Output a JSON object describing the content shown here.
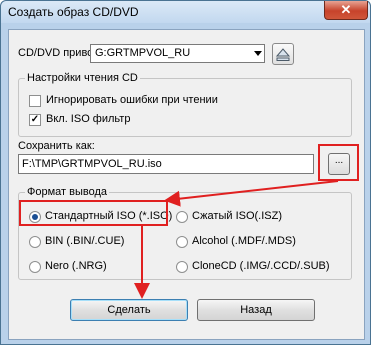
{
  "window": {
    "title": "Создать образ CD/DVD",
    "close_label": "✕"
  },
  "drive": {
    "label": "CD/DVD привод:",
    "selected": "G:GRTMPVOL_RU"
  },
  "read_settings": {
    "title": "Настройки чтения CD",
    "ignore_errors_label": "Игнорировать ошибки при чтении",
    "ignore_errors_checked": false,
    "iso_filter_label": "Вкл. ISO фильтр",
    "iso_filter_checked": true
  },
  "save_as": {
    "label": "Сохранить как:",
    "path": "F:\\TMP\\GRTMPVOL_RU.iso",
    "browse_label": "..."
  },
  "output_format": {
    "title": "Формат вывода",
    "selected": "Стандартный ISO (*.ISO)",
    "options": [
      "Стандартный ISO (*.ISO)",
      "Сжатый ISO(.ISZ)",
      "BIN (.BIN/.CUE)",
      "Alcohol (.MDF/.MDS)",
      "Nero (.NRG)",
      "CloneCD (.IMG/.CCD/.SUB)"
    ]
  },
  "buttons": {
    "make": "Сделать",
    "back": "Назад"
  },
  "colors": {
    "annotation": "#e02020",
    "radio_fill": "#1b4f94"
  }
}
